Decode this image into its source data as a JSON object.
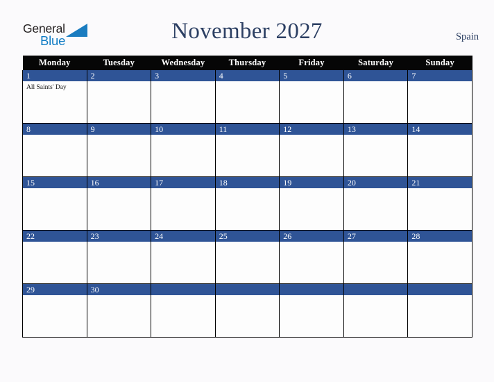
{
  "brand": {
    "name_part1": "General",
    "name_part2": "Blue",
    "triangle_color": "#1a7cc0",
    "text_color": "#231f20"
  },
  "header": {
    "title": "November 2027",
    "region": "Spain",
    "title_color": "#2c3f63"
  },
  "theme": {
    "page_background": "#fbfafc",
    "weekday_header_background": "#060606",
    "weekday_header_text": "#ffffff",
    "date_bar_background": "#2f5496",
    "date_bar_text": "#ffffff",
    "cell_background": "#fdfdfd",
    "grid_line": "#000000"
  },
  "weekdays": [
    "Monday",
    "Tuesday",
    "Wednesday",
    "Thursday",
    "Friday",
    "Saturday",
    "Sunday"
  ],
  "weeks": [
    [
      {
        "day": "1",
        "events": [
          "All Saints' Day"
        ]
      },
      {
        "day": "2",
        "events": []
      },
      {
        "day": "3",
        "events": []
      },
      {
        "day": "4",
        "events": []
      },
      {
        "day": "5",
        "events": []
      },
      {
        "day": "6",
        "events": []
      },
      {
        "day": "7",
        "events": []
      }
    ],
    [
      {
        "day": "8",
        "events": []
      },
      {
        "day": "9",
        "events": []
      },
      {
        "day": "10",
        "events": []
      },
      {
        "day": "11",
        "events": []
      },
      {
        "day": "12",
        "events": []
      },
      {
        "day": "13",
        "events": []
      },
      {
        "day": "14",
        "events": []
      }
    ],
    [
      {
        "day": "15",
        "events": []
      },
      {
        "day": "16",
        "events": []
      },
      {
        "day": "17",
        "events": []
      },
      {
        "day": "18",
        "events": []
      },
      {
        "day": "19",
        "events": []
      },
      {
        "day": "20",
        "events": []
      },
      {
        "day": "21",
        "events": []
      }
    ],
    [
      {
        "day": "22",
        "events": []
      },
      {
        "day": "23",
        "events": []
      },
      {
        "day": "24",
        "events": []
      },
      {
        "day": "25",
        "events": []
      },
      {
        "day": "26",
        "events": []
      },
      {
        "day": "27",
        "events": []
      },
      {
        "day": "28",
        "events": []
      }
    ],
    [
      {
        "day": "29",
        "events": []
      },
      {
        "day": "30",
        "events": []
      },
      {
        "day": "",
        "events": []
      },
      {
        "day": "",
        "events": []
      },
      {
        "day": "",
        "events": []
      },
      {
        "day": "",
        "events": []
      },
      {
        "day": "",
        "events": []
      }
    ]
  ]
}
